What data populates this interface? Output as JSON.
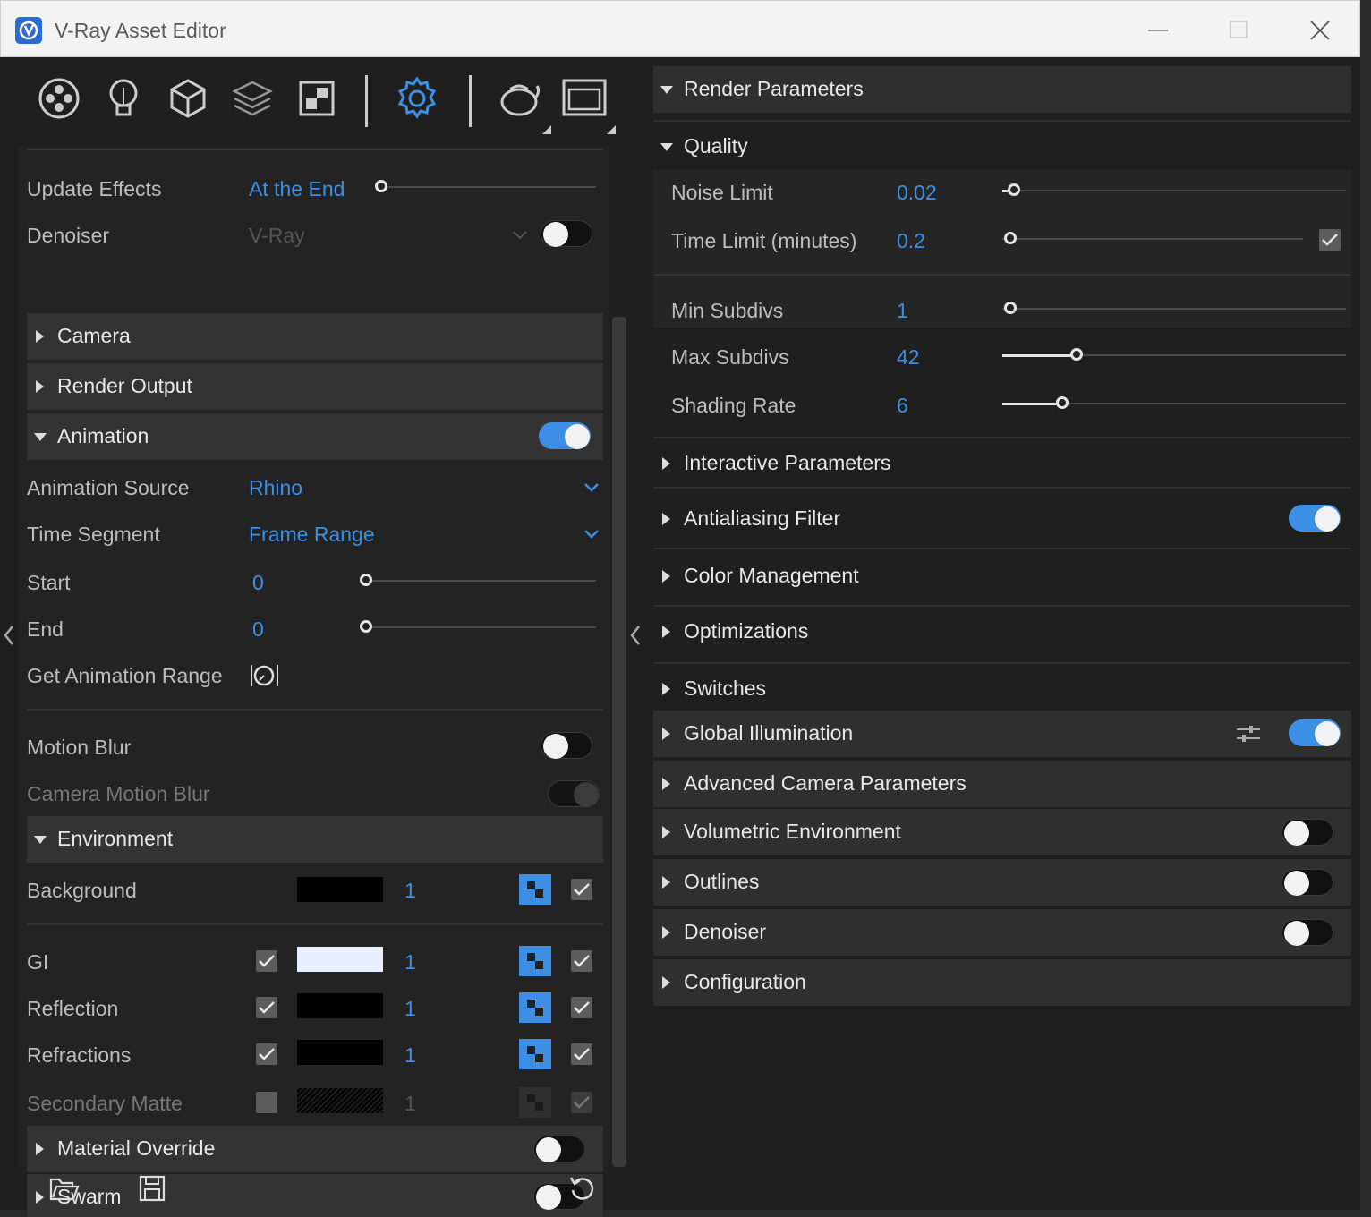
{
  "window": {
    "title": "V-Ray Asset Editor"
  },
  "toolbar": {
    "tabs": [
      "materials-icon",
      "lights-icon",
      "geometry-icon",
      "layers-icon",
      "textures-icon",
      "settings-icon",
      "render-icon",
      "render-window-icon"
    ]
  },
  "left": {
    "update_effects": {
      "label": "Update Effects",
      "value": "At the End"
    },
    "denoiser": {
      "label": "Denoiser",
      "value": "V-Ray",
      "enabled": false
    },
    "camera": {
      "label": "Camera"
    },
    "render_output": {
      "label": "Render Output"
    },
    "animation": {
      "label": "Animation",
      "enabled": true,
      "source": {
        "label": "Animation Source",
        "value": "Rhino"
      },
      "time_segment": {
        "label": "Time Segment",
        "value": "Frame Range"
      },
      "start": {
        "label": "Start",
        "value": "0"
      },
      "end": {
        "label": "End",
        "value": "0"
      },
      "get_range": {
        "label": "Get Animation Range"
      }
    },
    "motion_blur": {
      "label": "Motion Blur",
      "enabled": false
    },
    "camera_motion_blur": {
      "label": "Camera Motion Blur"
    },
    "environment": {
      "label": "Environment",
      "rows": [
        {
          "label": "Background",
          "multiplier": "1"
        },
        {
          "label": "GI",
          "multiplier": "1"
        },
        {
          "label": "Reflection",
          "multiplier": "1"
        },
        {
          "label": "Refractions",
          "multiplier": "1"
        },
        {
          "label": "Secondary Matte",
          "multiplier": "1"
        }
      ]
    },
    "material_override": {
      "label": "Material Override",
      "enabled": false
    },
    "swarm": {
      "label": "Swarm",
      "enabled": false
    }
  },
  "right": {
    "render_parameters": {
      "label": "Render Parameters"
    },
    "quality": {
      "label": "Quality",
      "noise_limit": {
        "label": "Noise Limit",
        "value": "0.02"
      },
      "time_limit": {
        "label": "Time Limit (minutes)",
        "value": "0.2"
      },
      "min_subdivs": {
        "label": "Min Subdivs",
        "value": "1"
      },
      "max_subdivs": {
        "label": "Max Subdivs",
        "value": "42"
      },
      "shading_rate": {
        "label": "Shading Rate",
        "value": "6"
      }
    },
    "sections": [
      {
        "label": "Interactive Parameters"
      },
      {
        "label": "Antialiasing Filter",
        "enabled": true
      },
      {
        "label": "Color Management"
      },
      {
        "label": "Optimizations"
      },
      {
        "label": "Switches"
      },
      {
        "label": "Global Illumination",
        "enabled": true
      },
      {
        "label": "Advanced Camera Parameters"
      },
      {
        "label": "Volumetric Environment",
        "enabled": false
      },
      {
        "label": "Outlines",
        "enabled": false
      },
      {
        "label": "Denoiser",
        "enabled": false
      },
      {
        "label": "Configuration"
      }
    ]
  },
  "colors": {
    "accent": "#3d8fe6",
    "background": "#1f1f1f",
    "section": "#333333"
  }
}
